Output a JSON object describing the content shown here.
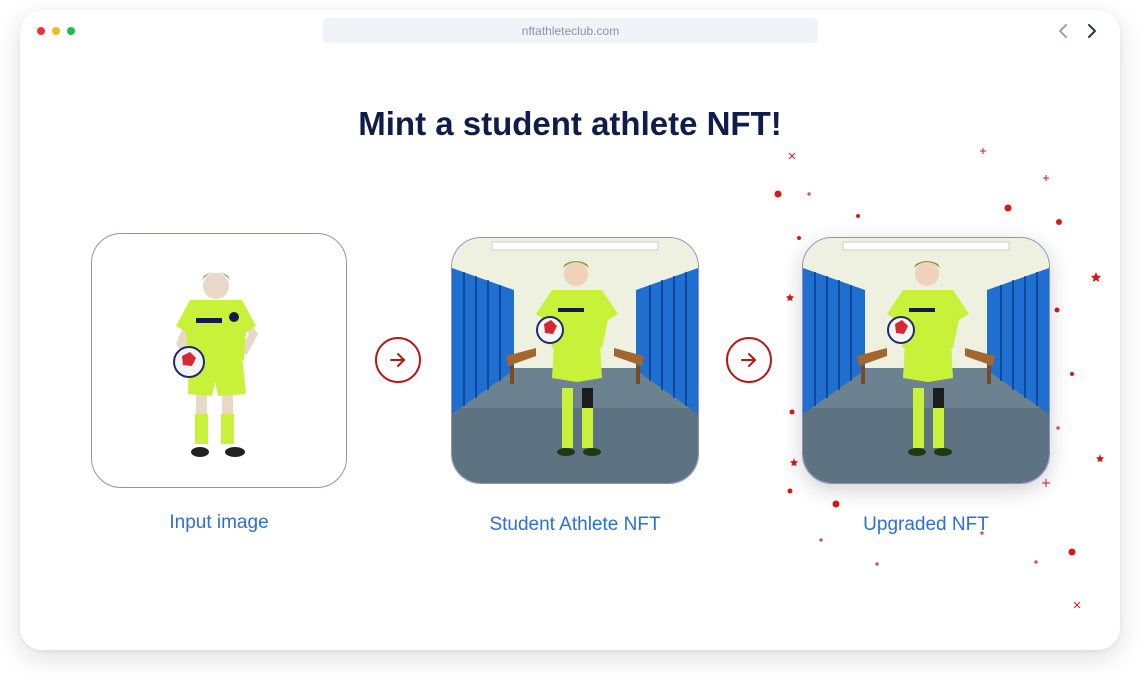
{
  "browser": {
    "url": "nftathleteclub.com",
    "icons": {
      "back": "chevron-left-icon",
      "forward": "chevron-right-icon"
    }
  },
  "page": {
    "title": "Mint a student athlete NFT!"
  },
  "steps": [
    {
      "label": "Input image"
    },
    {
      "label": "Student Athlete NFT"
    },
    {
      "label": "Upgraded NFT"
    }
  ],
  "colors": {
    "title": "#0f1d4a",
    "label": "#2d6fd6",
    "accent": "#b81818",
    "jersey": "#c8f23a",
    "locker": "#1f6fd0"
  }
}
